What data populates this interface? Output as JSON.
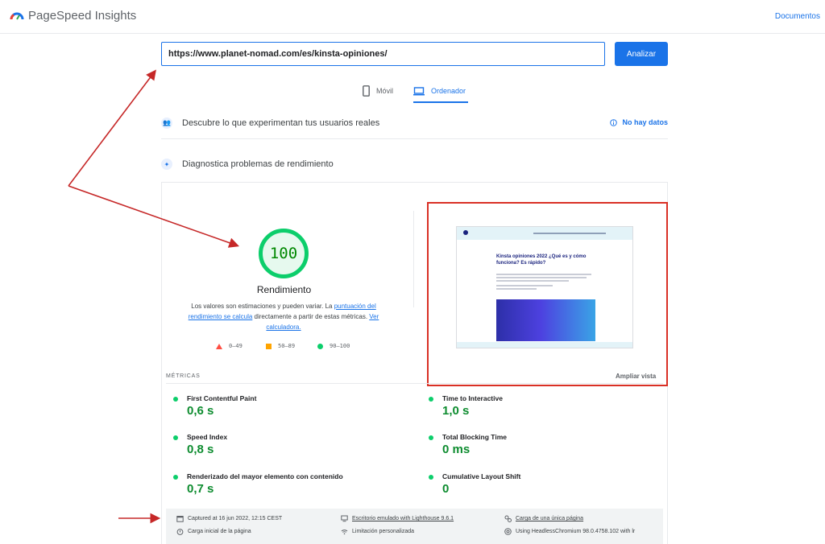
{
  "header": {
    "app_name": "PageSpeed Insights",
    "docs_link": "Documentos"
  },
  "search": {
    "url_value": "https://www.planet-nomad.com/es/kinsta-opiniones/",
    "analyze_label": "Analizar"
  },
  "tabs": [
    {
      "label": "Móvil",
      "icon": "phone-icon"
    },
    {
      "label": "Ordenador",
      "icon": "laptop-icon",
      "active": true
    }
  ],
  "field_data": {
    "title": "Descubre lo que experimentan tus usuarios reales",
    "status": "No hay datos"
  },
  "lab_data": {
    "title": "Diagnostica problemas de rendimiento"
  },
  "performance": {
    "score": "100",
    "title": "Rendimiento",
    "desc_part1": "Los valores son estimaciones y pueden variar. La ",
    "desc_link1": "puntuación del rendimiento se calcula",
    "desc_part2": " directamente a partir de estas métricas. ",
    "desc_link2": "Ver calculadora.",
    "legend": [
      {
        "range": "0–49",
        "shape": "triangle",
        "color": "#ff4e42"
      },
      {
        "range": "50–89",
        "shape": "square",
        "color": "#ffa400"
      },
      {
        "range": "90–100",
        "shape": "circle",
        "color": "#0cce6b"
      }
    ]
  },
  "screenshot": {
    "page_title": "Kinsta opiniones 2022 ¿Qué es y cómo funciona? Es rápido?",
    "expand_label": "Ampliar vista"
  },
  "metrics": {
    "label": "MÉTRICAS",
    "items": [
      {
        "name": "First Contentful Paint",
        "value": "0,6 s"
      },
      {
        "name": "Time to Interactive",
        "value": "1,0 s"
      },
      {
        "name": "Speed Index",
        "value": "0,8 s"
      },
      {
        "name": "Total Blocking Time",
        "value": "0 ms"
      },
      {
        "name": "Renderizado del mayor elemento con contenido",
        "value": "0,7 s"
      },
      {
        "name": "Cumulative Layout Shift",
        "value": "0"
      }
    ]
  },
  "run_info": {
    "captured": "Captured at 16 jun 2022, 12:15 CEST",
    "emulated": "Escritorio emulado with Lighthouse 9.6.1",
    "single_page": "Carga de una única página",
    "initial_load": "Carga inicial de la página",
    "throttling": "Limitación personalizada",
    "browser": "Using HeadlessChromium 98.0.4758.102 with lr"
  },
  "colors": {
    "accent": "#1a73e8",
    "pass": "#0cce6b",
    "pass_text": "#0d8c2f",
    "annotation": "#d93025"
  }
}
